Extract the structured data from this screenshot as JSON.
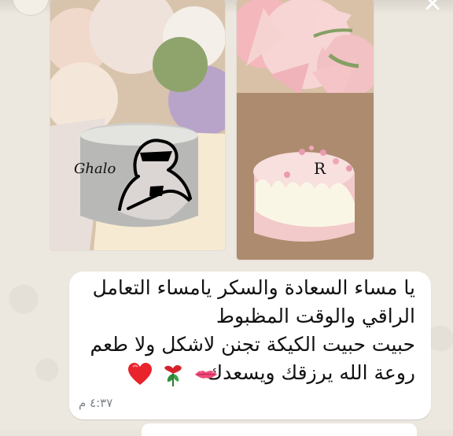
{
  "chat": {
    "sender_name": "",
    "message_lines": [
      "يا مساء السعادة والسكر يامساء التعامل",
      "الراقي والوقت المظبوط",
      "حبيت حبيت الكيكة تجنن لاشكل ولا طعم",
      "روعة الله يرزقك ويسعدك"
    ],
    "timestamp": "٤:٣٧ م",
    "emojis": [
      "kiss-mark-icon",
      "rose-icon",
      "red-heart-icon"
    ]
  },
  "images": [
    {
      "name": "grey-cake-photo",
      "description_text": "Ghalo"
    },
    {
      "name": "pink-cake-photo",
      "description_text": "R"
    }
  ]
}
